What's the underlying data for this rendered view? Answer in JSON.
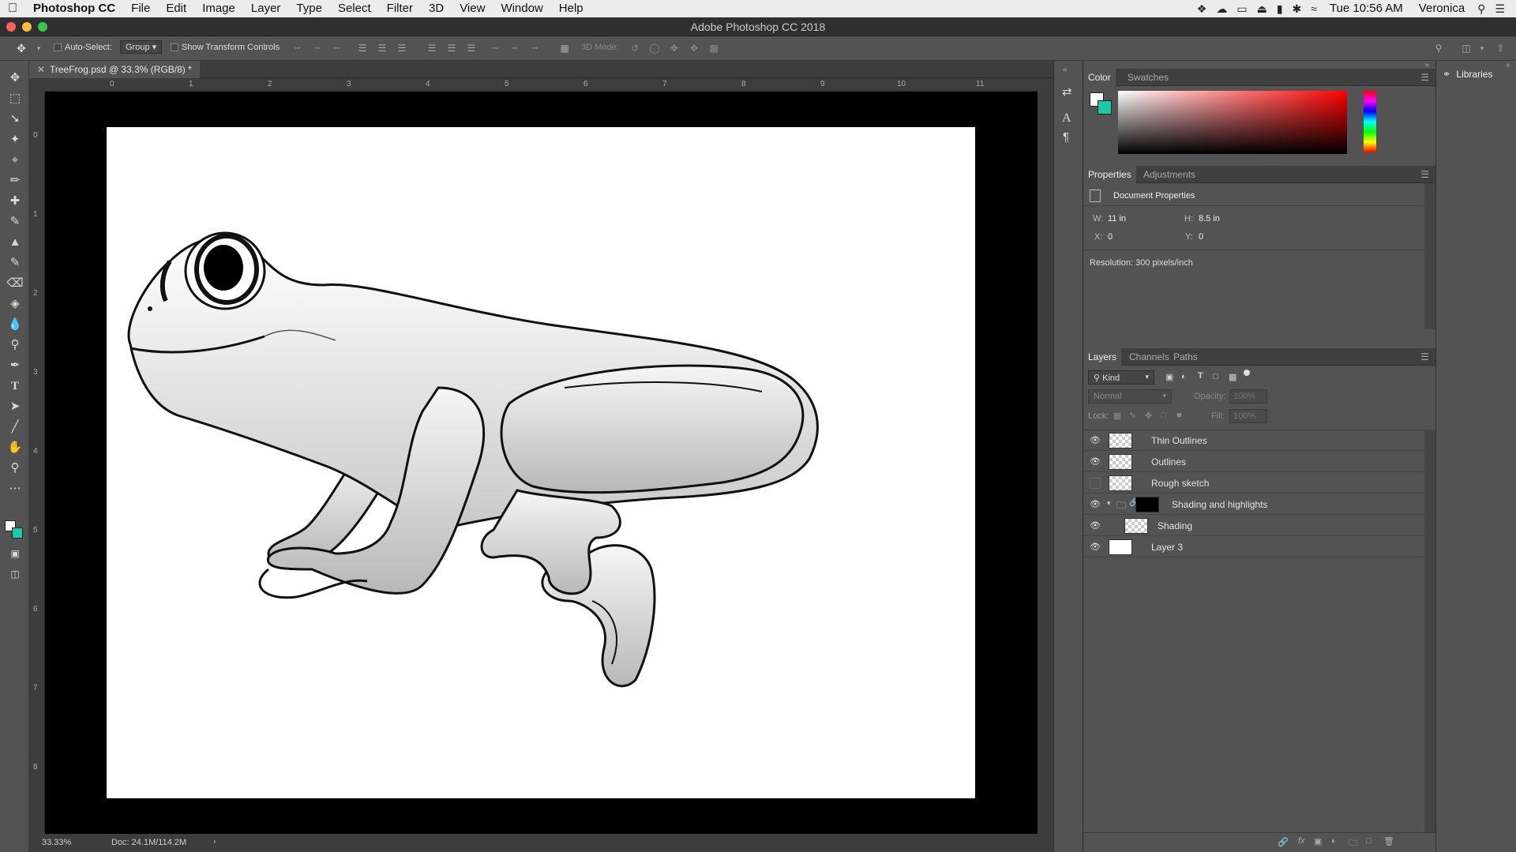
{
  "menubar": {
    "app": "Photoshop CC",
    "items": [
      "File",
      "Edit",
      "Image",
      "Layer",
      "Type",
      "Select",
      "Filter",
      "3D",
      "View",
      "Window",
      "Help"
    ],
    "clock": "Tue 10:56 AM",
    "user": "Veronica"
  },
  "window": {
    "title": "Adobe Photoshop CC 2018"
  },
  "options": {
    "auto_select_label": "Auto-Select:",
    "auto_select_value": "Group",
    "transform_label": "Show Transform Controls",
    "mode3d_label": "3D Mode:"
  },
  "document": {
    "tab_label": "TreeFrog.psd @ 33.3% (RGB/8) *",
    "hruler_ticks": [
      "0",
      "1",
      "2",
      "3",
      "4",
      "5",
      "6",
      "7",
      "8",
      "9",
      "10",
      "11"
    ],
    "vruler_ticks": [
      "0",
      "1",
      "2",
      "3",
      "4",
      "5",
      "6",
      "7",
      "8"
    ],
    "zoom": "33.33%",
    "doc_size": "Doc: 24.1M/114.2M"
  },
  "color_panel": {
    "tabs": [
      "Color",
      "Swatches"
    ],
    "foreground": "#ffffff",
    "background": "#1ec7a8"
  },
  "properties_panel": {
    "tabs": [
      "Properties",
      "Adjustments"
    ],
    "heading": "Document Properties",
    "w_label": "W:",
    "w_value": "11 in",
    "h_label": "H:",
    "h_value": "8.5 in",
    "x_label": "X:",
    "x_value": "0",
    "y_label": "Y:",
    "y_value": "0",
    "resolution": "Resolution: 300 pixels/inch"
  },
  "layers_panel": {
    "tabs": [
      "Layers",
      "Channels",
      "Paths"
    ],
    "filter_kind": "Kind",
    "blend_mode": "Normal",
    "opacity_label": "Opacity:",
    "opacity_value": "100%",
    "lock_label": "Lock:",
    "fill_label": "Fill:",
    "fill_value": "100%",
    "layers": [
      {
        "name": "Thin Outlines",
        "visible": true
      },
      {
        "name": "Outlines",
        "visible": true
      },
      {
        "name": "Rough sketch",
        "visible": false
      },
      {
        "name": "Shading and highlights",
        "visible": true,
        "group": true
      },
      {
        "name": "Shading",
        "visible": true
      },
      {
        "name": "Layer 3",
        "visible": true
      }
    ]
  },
  "libraries": {
    "label": "Libraries"
  }
}
